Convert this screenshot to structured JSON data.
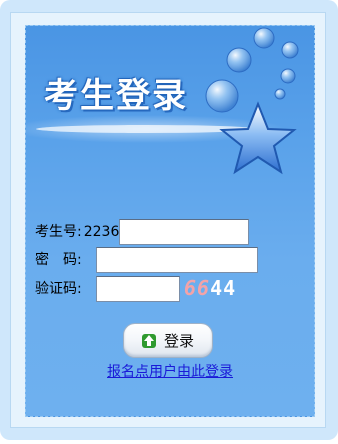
{
  "login": {
    "title": "考生登录",
    "fields": {
      "exam_number_label": "考生号:",
      "exam_number_prefix": "2236",
      "exam_number_value": "",
      "password_label": "密　码:",
      "password_value": "",
      "captcha_label": "验证码:",
      "captcha_value": ""
    },
    "captcha_code": [
      "6",
      "6",
      "4",
      "4"
    ],
    "login_button_label": "登录",
    "agency_link": "报名点用户由此登录"
  },
  "colors": {
    "panel_top": "#4a95e4",
    "panel_bottom": "#6eb0ef",
    "star": "#4f8fe8",
    "link": "#1a1ad8"
  }
}
